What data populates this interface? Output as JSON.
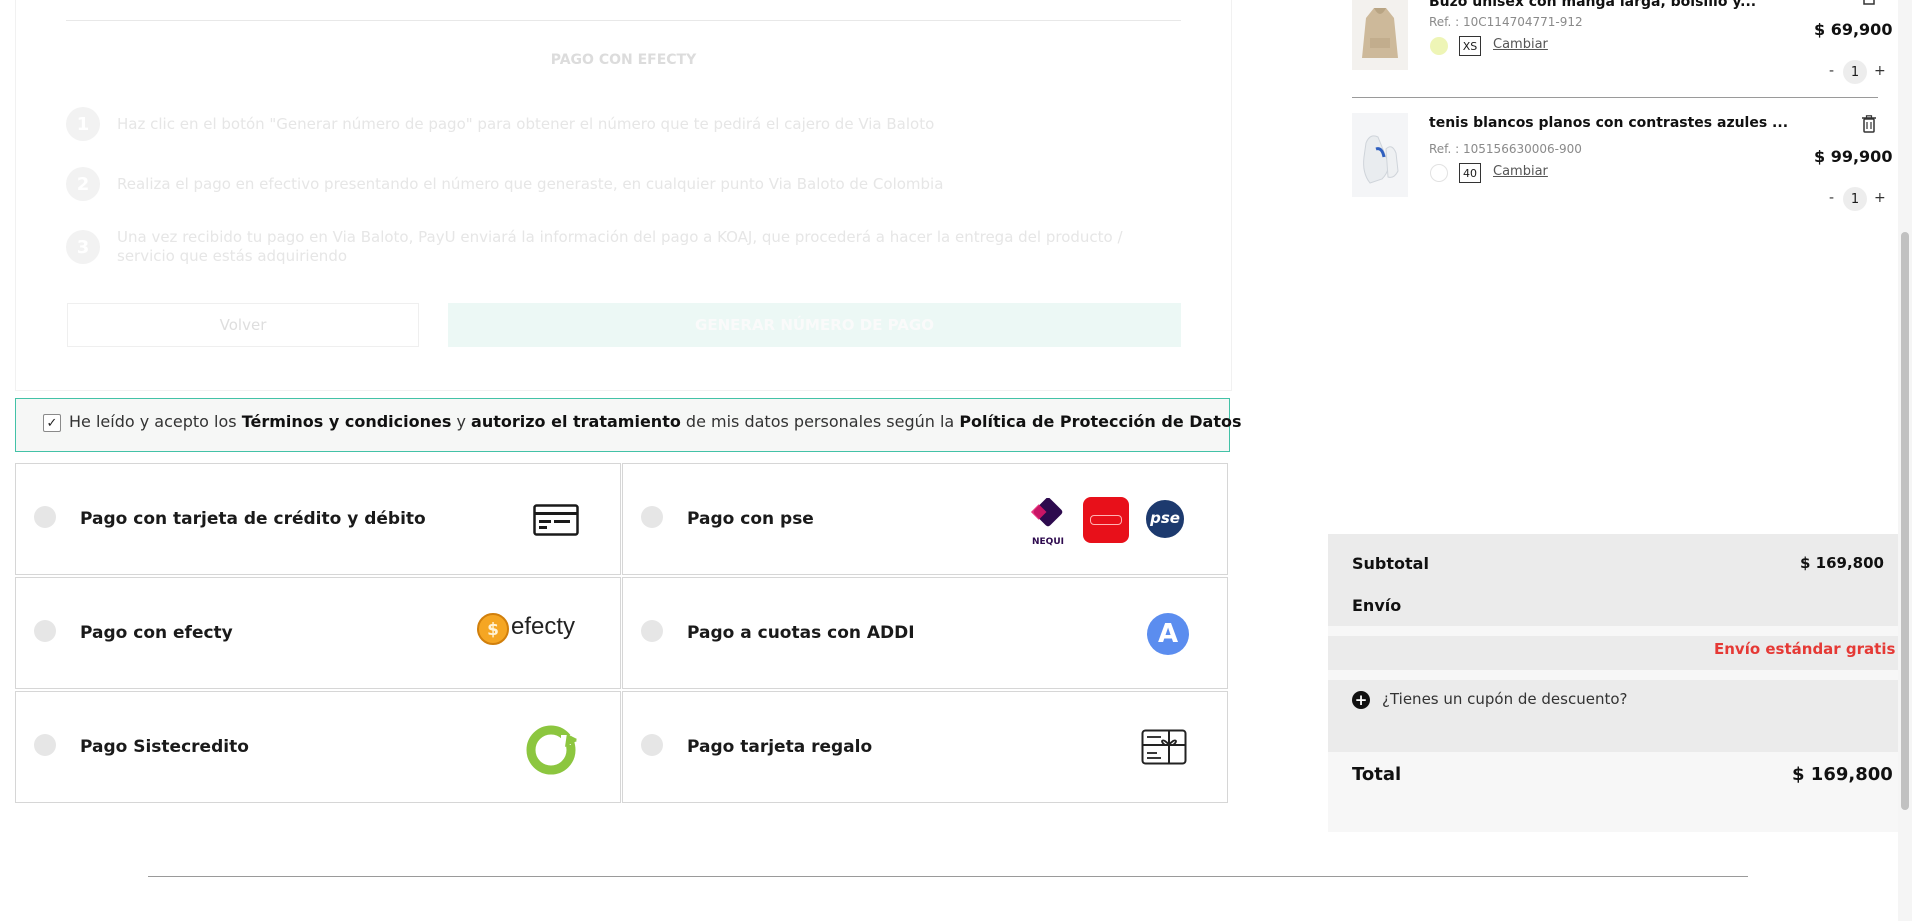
{
  "efecty": {
    "title": "PAGO CON EFECTY",
    "steps": [
      {
        "n": "1",
        "text": "Haz clic en el botón \"Generar número de pago\" para obtener el número que te pedirá el cajero de Via Baloto"
      },
      {
        "n": "2",
        "text": "Realiza el pago en efectivo presentando el número que generaste, en cualquier punto Via Baloto de Colombia"
      },
      {
        "n": "3",
        "text": "Una vez recibido tu pago en Via Baloto, PayU enviará la información del pago a KOAJ, que procederá a hacer la entrega del producto / servicio que estás adquiriendo"
      }
    ],
    "back_label": "Volver",
    "generate_label": "GENERAR NÚMERO DE PAGO"
  },
  "terms": {
    "t1": "He leído y acepto los ",
    "t2": "Términos y condiciones",
    "t3": " y ",
    "t4": "autorizo el tratamiento",
    "t5": " de mis datos personales según la ",
    "t6": "Política de Protección de Datos",
    "checked": true
  },
  "payment_options": {
    "card": "Pago con tarjeta de crédito y débito",
    "pse": "Pago con pse",
    "efecty": "Pago con efecty",
    "addi": "Pago a cuotas con ADDI",
    "sistecredito": "Pago Sistecredito",
    "gift": "Pago tarjeta regalo"
  },
  "logos": {
    "efecty_word": "efecty",
    "nequi_word": "NEQUI",
    "pse_word": "pse",
    "addi_letter": "A"
  },
  "cart": {
    "items": [
      {
        "name": "Buzo unisex con manga larga, bolsillo y...",
        "ref": "Ref. : 10C114704771-912",
        "size": "XS",
        "change": "Cambiar",
        "price": "$ 69,900",
        "qty": "1",
        "swatch": "#eef5b6"
      },
      {
        "name": "tenis blancos planos con contrastes azules ...",
        "ref": "Ref. : 105156630006-900",
        "size": "40",
        "change": "Cambiar",
        "price": "$ 99,900",
        "qty": "1",
        "swatch": "#ffffff"
      }
    ],
    "minus": "-",
    "plus": "+"
  },
  "summary": {
    "subtotal_label": "Subtotal",
    "subtotal_value": "$ 169,800",
    "shipping_label": "Envío",
    "shipping_value": "Envío estándar gratis",
    "coupon_label": "¿Tienes un cupón de descuento?",
    "total_label": "Total",
    "total_value": "$ 169,800"
  },
  "colors": {
    "accent": "#43c2a7",
    "shipping_red": "#e53935",
    "addi_blue": "#5b8def",
    "sistecredito_green": "#8cc63f"
  }
}
